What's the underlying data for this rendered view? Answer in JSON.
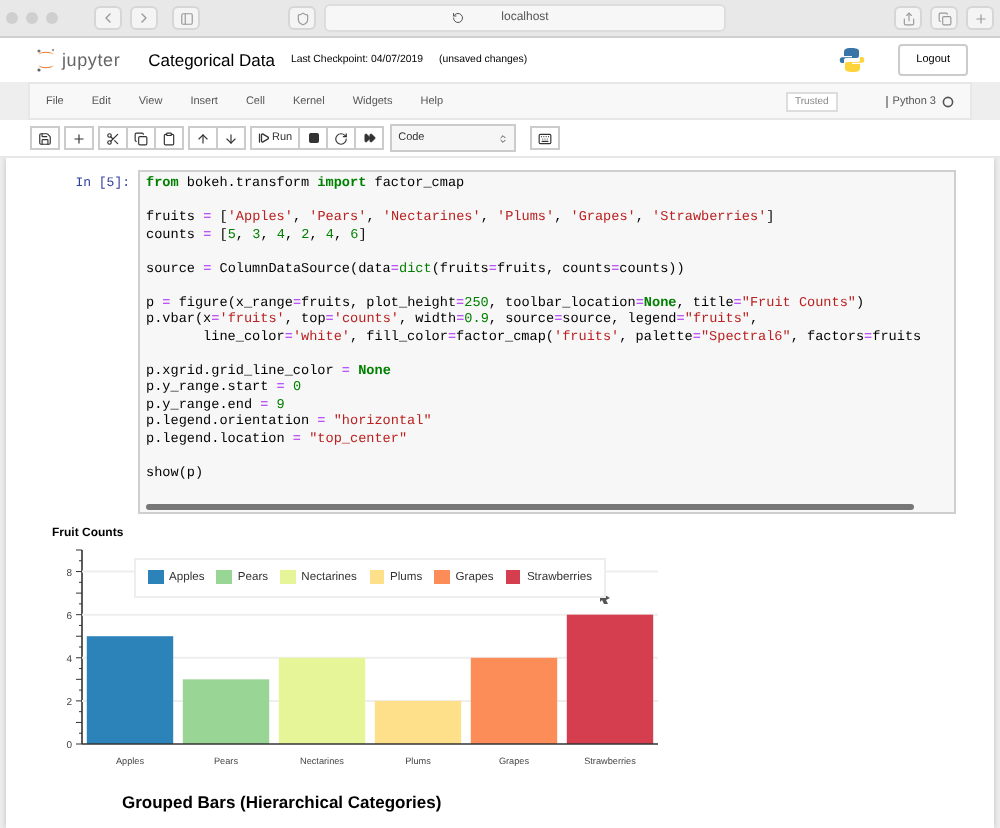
{
  "browser": {
    "url": "localhost"
  },
  "header": {
    "logo_text": "jupyter",
    "title": "Categorical Data",
    "checkpoint": "Last Checkpoint: 04/07/2019",
    "status": "(unsaved changes)",
    "logout": "Logout"
  },
  "menu": [
    "File",
    "Edit",
    "View",
    "Insert",
    "Cell",
    "Kernel",
    "Widgets",
    "Help"
  ],
  "trusted": "Trusted",
  "kernel": "Python 3",
  "toolbar": {
    "run": "Run",
    "cell_type": "Code"
  },
  "cell": {
    "prompt": "In [5]:",
    "blocks": [
      [
        [
          {
            "text": "from",
            "kind": "keyword"
          },
          {
            "text": " bokeh.transform ",
            "kind": "plain"
          },
          {
            "text": "import",
            "kind": "keyword"
          },
          {
            "text": " factor_cmap",
            "kind": "plain"
          }
        ]
      ],
      [
        [
          {
            "text": "fruits ",
            "kind": "plain"
          },
          {
            "text": "=",
            "kind": "operator"
          },
          {
            "text": " [",
            "kind": "plain"
          },
          {
            "text": "'Apples'",
            "kind": "string"
          },
          {
            "text": ", ",
            "kind": "plain"
          },
          {
            "text": "'Pears'",
            "kind": "string"
          },
          {
            "text": ", ",
            "kind": "plain"
          },
          {
            "text": "'Nectarines'",
            "kind": "string"
          },
          {
            "text": ", ",
            "kind": "plain"
          },
          {
            "text": "'Plums'",
            "kind": "string"
          },
          {
            "text": ", ",
            "kind": "plain"
          },
          {
            "text": "'Grapes'",
            "kind": "string"
          },
          {
            "text": ", ",
            "kind": "plain"
          },
          {
            "text": "'Strawberries'",
            "kind": "string"
          },
          {
            "text": "]",
            "kind": "plain"
          }
        ],
        [
          {
            "text": "counts ",
            "kind": "plain"
          },
          {
            "text": "=",
            "kind": "operator"
          },
          {
            "text": " [",
            "kind": "plain"
          },
          {
            "text": "5",
            "kind": "number"
          },
          {
            "text": ", ",
            "kind": "plain"
          },
          {
            "text": "3",
            "kind": "number"
          },
          {
            "text": ", ",
            "kind": "plain"
          },
          {
            "text": "4",
            "kind": "number"
          },
          {
            "text": ", ",
            "kind": "plain"
          },
          {
            "text": "2",
            "kind": "number"
          },
          {
            "text": ", ",
            "kind": "plain"
          },
          {
            "text": "4",
            "kind": "number"
          },
          {
            "text": ", ",
            "kind": "plain"
          },
          {
            "text": "6",
            "kind": "number"
          },
          {
            "text": "]",
            "kind": "plain"
          }
        ]
      ],
      [
        [
          {
            "text": "source ",
            "kind": "plain"
          },
          {
            "text": "=",
            "kind": "operator"
          },
          {
            "text": " ColumnDataSource(data",
            "kind": "plain"
          },
          {
            "text": "=",
            "kind": "operator"
          },
          {
            "text": "dict",
            "kind": "builtin"
          },
          {
            "text": "(fruits",
            "kind": "plain"
          },
          {
            "text": "=",
            "kind": "operator"
          },
          {
            "text": "fruits, counts",
            "kind": "plain"
          },
          {
            "text": "=",
            "kind": "operator"
          },
          {
            "text": "counts))",
            "kind": "plain"
          }
        ]
      ],
      [
        [
          {
            "text": "p ",
            "kind": "plain"
          },
          {
            "text": "=",
            "kind": "operator"
          },
          {
            "text": " figure(x_range",
            "kind": "plain"
          },
          {
            "text": "=",
            "kind": "operator"
          },
          {
            "text": "fruits, plot_height",
            "kind": "plain"
          },
          {
            "text": "=",
            "kind": "operator"
          },
          {
            "text": "250",
            "kind": "number"
          },
          {
            "text": ", toolbar_location",
            "kind": "plain"
          },
          {
            "text": "=",
            "kind": "operator"
          },
          {
            "text": "None",
            "kind": "keyword"
          },
          {
            "text": ", title",
            "kind": "plain"
          },
          {
            "text": "=",
            "kind": "operator"
          },
          {
            "text": "\"Fruit Counts\"",
            "kind": "string"
          },
          {
            "text": ")",
            "kind": "plain"
          }
        ],
        [
          {
            "text": "p.vbar(x",
            "kind": "plain"
          },
          {
            "text": "=",
            "kind": "operator"
          },
          {
            "text": "'fruits'",
            "kind": "string"
          },
          {
            "text": ", top",
            "kind": "plain"
          },
          {
            "text": "=",
            "kind": "operator"
          },
          {
            "text": "'counts'",
            "kind": "string"
          },
          {
            "text": ", width",
            "kind": "plain"
          },
          {
            "text": "=",
            "kind": "operator"
          },
          {
            "text": "0.9",
            "kind": "number"
          },
          {
            "text": ", source",
            "kind": "plain"
          },
          {
            "text": "=",
            "kind": "operator"
          },
          {
            "text": "source, legend",
            "kind": "plain"
          },
          {
            "text": "=",
            "kind": "operator"
          },
          {
            "text": "\"fruits\"",
            "kind": "string"
          },
          {
            "text": ",",
            "kind": "plain"
          }
        ],
        [
          {
            "text": "       line_color",
            "kind": "plain"
          },
          {
            "text": "=",
            "kind": "operator"
          },
          {
            "text": "'white'",
            "kind": "string"
          },
          {
            "text": ", fill_color",
            "kind": "plain"
          },
          {
            "text": "=",
            "kind": "operator"
          },
          {
            "text": "factor_cmap(",
            "kind": "plain"
          },
          {
            "text": "'fruits'",
            "kind": "string"
          },
          {
            "text": ", palette",
            "kind": "plain"
          },
          {
            "text": "=",
            "kind": "operator"
          },
          {
            "text": "\"Spectral6\"",
            "kind": "string"
          },
          {
            "text": ", factors",
            "kind": "plain"
          },
          {
            "text": "=",
            "kind": "operator"
          },
          {
            "text": "fruits",
            "kind": "plain"
          }
        ]
      ],
      [
        [
          {
            "text": "p.xgrid.grid_line_color ",
            "kind": "plain"
          },
          {
            "text": "=",
            "kind": "operator"
          },
          {
            "text": " None",
            "kind": "keyword"
          }
        ],
        [
          {
            "text": "p.y_range.start ",
            "kind": "plain"
          },
          {
            "text": "=",
            "kind": "operator"
          },
          {
            "text": " 0",
            "kind": "number"
          }
        ],
        [
          {
            "text": "p.y_range.end ",
            "kind": "plain"
          },
          {
            "text": "=",
            "kind": "operator"
          },
          {
            "text": " 9",
            "kind": "number"
          }
        ],
        [
          {
            "text": "p.legend.orientation ",
            "kind": "plain"
          },
          {
            "text": "=",
            "kind": "operator"
          },
          {
            "text": " \"horizontal\"",
            "kind": "string"
          }
        ],
        [
          {
            "text": "p.legend.location ",
            "kind": "plain"
          },
          {
            "text": "=",
            "kind": "operator"
          },
          {
            "text": " \"top_center\"",
            "kind": "string"
          }
        ]
      ],
      [
        [
          {
            "text": "show(p)",
            "kind": "plain"
          }
        ]
      ]
    ]
  },
  "output": {
    "chart_data": {
      "type": "bar",
      "title": "Fruit Counts",
      "categories": [
        "Apples",
        "Pears",
        "Nectarines",
        "Plums",
        "Grapes",
        "Strawberries"
      ],
      "values": [
        5,
        3,
        4,
        2,
        4,
        6
      ],
      "ylim": [
        0,
        9
      ],
      "yticks": [
        0,
        2,
        4,
        6,
        8
      ],
      "grid": true
    },
    "legend": [
      {
        "label": "Apples",
        "color": "#2b83ba"
      },
      {
        "label": "Pears",
        "color": "#99d594"
      },
      {
        "label": "Nectarines",
        "color": "#e6f598"
      },
      {
        "label": "Plums",
        "color": "#fee08b"
      },
      {
        "label": "Grapes",
        "color": "#fc8d59"
      },
      {
        "label": "Strawberries",
        "color": "#d53e4f"
      }
    ]
  },
  "next_heading": "Grouped Bars (Hierarchical Categories)"
}
